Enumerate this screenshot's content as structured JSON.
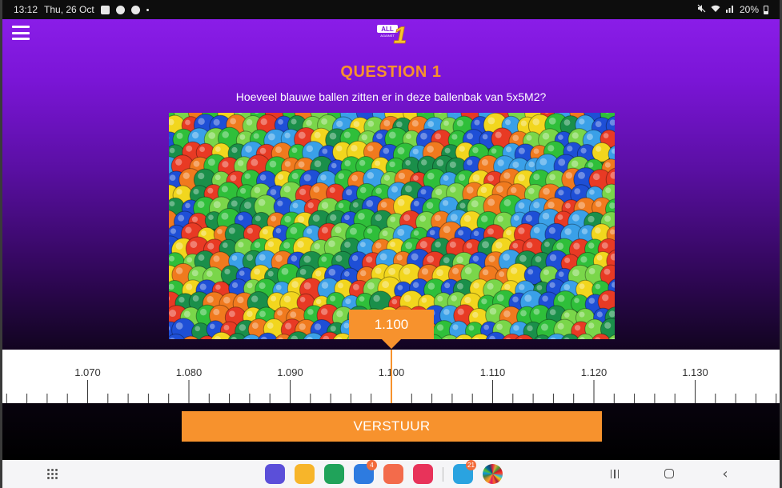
{
  "status_bar": {
    "time": "13:12",
    "date": "Thu, 26 Oct",
    "battery": "20%",
    "icons_left": [
      "gallery-icon",
      "messages-icon",
      "chat-icon",
      "dot-icon"
    ],
    "icons_right": [
      "mute-icon",
      "wifi-icon",
      "signal-icon",
      "battery-icon"
    ]
  },
  "header": {
    "menu_icon": "hamburger-menu-icon",
    "logo_text_top": "ALL",
    "logo_text_small": "AGAINST",
    "logo_numeral": "1"
  },
  "question": {
    "title": "QUESTION 1",
    "text": "Hoeveel blauwe ballen zitten er in deze ballenbak van 5x5M2?",
    "image": "ball-pit-photo"
  },
  "slider": {
    "current_value_label": "1.100",
    "tick_labels": [
      "1.070",
      "1.080",
      "1.090",
      "1.100",
      "1.110",
      "1.120",
      "1.130"
    ],
    "center_value": 1100,
    "major_step": 10,
    "minor_step": 2
  },
  "submit": {
    "label": "VERSTUUR"
  },
  "navbar": {
    "apps_icon": "app-drawer-icon",
    "dock": [
      {
        "name": "internet-app-icon",
        "color": "#5b4fd9",
        "badge": ""
      },
      {
        "name": "files-app-icon",
        "color": "#f7b52a",
        "badge": ""
      },
      {
        "name": "phone-app-icon",
        "color": "#20a35a",
        "badge": ""
      },
      {
        "name": "messages-app-icon",
        "color": "#2d7be0",
        "badge": "4"
      },
      {
        "name": "contacts-app-icon",
        "color": "#f36b4b",
        "badge": ""
      },
      {
        "name": "camera-app-icon",
        "color": "#e8335a",
        "badge": ""
      },
      {
        "name": "telegram-app-icon",
        "color": "#2aa3e0",
        "badge": "21"
      },
      {
        "name": "goals-app-icon",
        "color": "#ffffff",
        "badge": ""
      }
    ],
    "recent_icon": "recent-apps-icon",
    "home_icon": "home-icon",
    "back_icon": "back-icon"
  },
  "colors": {
    "accent": "#f7922d",
    "purple": "#8a1de8",
    "ruler_background": "#ffffff"
  }
}
